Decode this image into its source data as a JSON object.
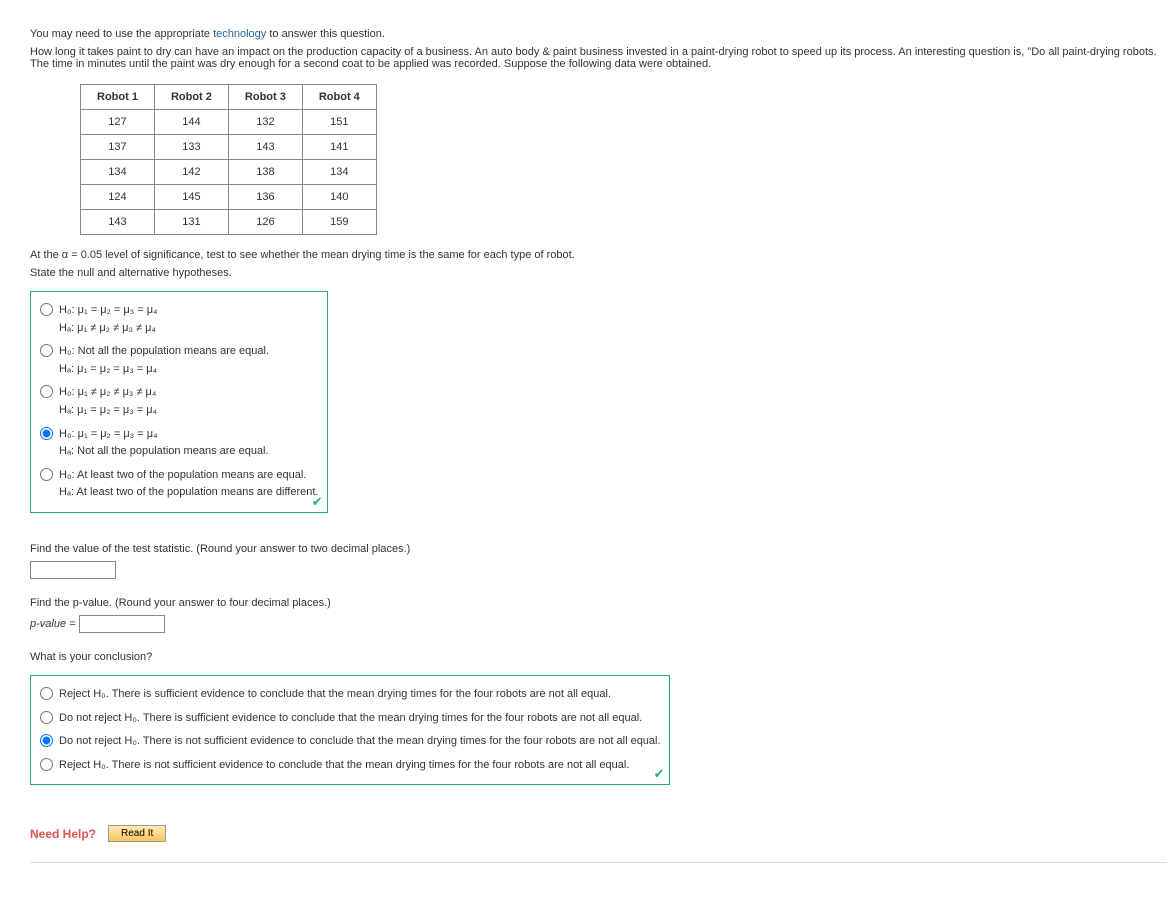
{
  "intro": {
    "line1a": "You may need to use the appropriate ",
    "tech": "technology",
    "line1b": " to answer this question.",
    "line2": "How long it takes paint to dry can have an impact on the production capacity of a business. An auto body & paint business invested in a paint-drying robot to speed up its process. An interesting question is, \"Do all paint-drying robots. The time in minutes until the paint was dry enough for a second coat to be applied was recorded. Suppose the following data were obtained."
  },
  "table": {
    "headers": [
      "Robot 1",
      "Robot 2",
      "Robot 3",
      "Robot 4"
    ],
    "rows": [
      [
        "127",
        "144",
        "132",
        "151"
      ],
      [
        "137",
        "133",
        "143",
        "141"
      ],
      [
        "134",
        "142",
        "138",
        "134"
      ],
      [
        "124",
        "145",
        "136",
        "140"
      ],
      [
        "143",
        "131",
        "126",
        "159"
      ]
    ]
  },
  "q1": {
    "prompt": "At the α = 0.05 level of significance, test to see whether the mean drying time is the same for each type of robot.",
    "sub": "State the null and alternative hypotheses.",
    "options": {
      "a": {
        "h0": "H₀: μ₁ = μ₂ = μ₃ = μ₄",
        "ha": "Hₐ: μ₁ ≠ μ₂ ≠ μ₃ ≠ μ₄"
      },
      "b": {
        "h0": "H₀: Not all the population means are equal.",
        "ha": "Hₐ: μ₁ = μ₂ = μ₃ = μ₄"
      },
      "c": {
        "h0": "H₀: μ₁ ≠ μ₂ ≠ μ₃ ≠ μ₄",
        "ha": "Hₐ: μ₁ = μ₂ = μ₃ = μ₄"
      },
      "d": {
        "h0": "H₀: μ₁ = μ₂ = μ₃ = μ₄",
        "ha": "Hₐ: Not all the population means are equal."
      },
      "e": {
        "h0": "H₀: At least two of the population means are equal.",
        "ha": "Hₐ: At least two of the population means are different."
      }
    }
  },
  "q2": {
    "prompt": "Find the value of the test statistic. (Round your answer to two decimal places.)"
  },
  "q3": {
    "prompt": "Find the p-value. (Round your answer to four decimal places.)",
    "label": "p-value = "
  },
  "q4": {
    "prompt": "What is your conclusion?",
    "options": {
      "a": "Reject H₀. There is sufficient evidence to conclude that the mean drying times for the four robots are not all equal.",
      "b": "Do not reject H₀. There is sufficient evidence to conclude that the mean drying times for the four robots are not all equal.",
      "c": "Do not reject H₀. There is not sufficient evidence to conclude that the mean drying times for the four robots are not all equal.",
      "d": "Reject H₀. There is not sufficient evidence to conclude that the mean drying times for the four robots are not all equal."
    }
  },
  "help": {
    "label": "Need Help?",
    "button": "Read It"
  }
}
